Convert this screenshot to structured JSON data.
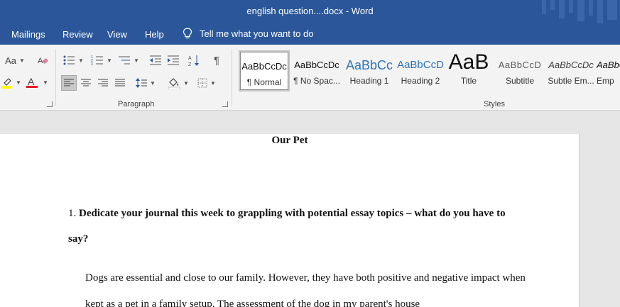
{
  "window": {
    "title": "english question....docx  -  Word"
  },
  "menu": {
    "tabs": [
      "Mailings",
      "Review",
      "View",
      "Help"
    ],
    "tell_me": "Tell me what you want to do"
  },
  "ribbon": {
    "font": {
      "font_size_label": "Aa"
    },
    "paragraph": {
      "label": "Paragraph"
    },
    "styles": {
      "label": "Styles",
      "items": [
        {
          "preview": "AaBbCcDc",
          "name": "¶ Normal"
        },
        {
          "preview": "AaBbCcDc",
          "name": "¶ No Spac..."
        },
        {
          "preview": "AaBbCc",
          "name": "Heading 1"
        },
        {
          "preview": "AaBbCcD",
          "name": "Heading 2"
        },
        {
          "preview": "AaB",
          "name": "Title"
        },
        {
          "preview": "AaBbCcD",
          "name": "Subtitle"
        },
        {
          "preview": "AaBbCcDc",
          "name": "Subtle Em..."
        },
        {
          "preview": "AaBbC",
          "name": "Emp"
        }
      ]
    }
  },
  "colors": {
    "accent": "#2b579a",
    "highlight": "#ffff00",
    "font_color": "#e81123"
  },
  "document": {
    "title": "Our Pet",
    "question_number": "1.",
    "question_text": "Dedicate your journal this week to grappling with potential essay topics – what do you have to say?",
    "paragraph": "Dogs are essential and close to our family. However, they have both positive and negative impact when kept as a pet in a family setup. The assessment of the dog in my parent's house"
  }
}
